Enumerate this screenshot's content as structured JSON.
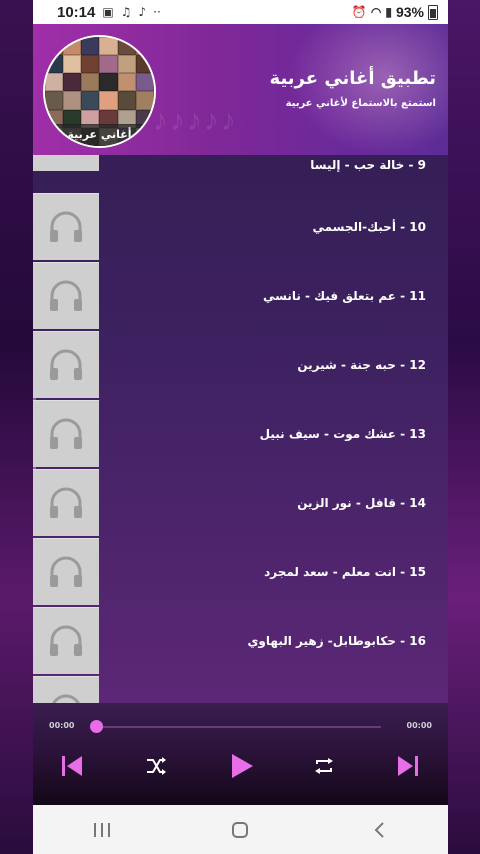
{
  "status_bar": {
    "time": "10:14",
    "battery": "93%"
  },
  "header": {
    "title": "تطبيق أغاني عربية",
    "subtitle": "استمتع بالاستماع لأغاني عربية",
    "avatar_label": "أغاني عربية"
  },
  "songs": [
    {
      "label": "9 - خالة حب - إليسا"
    },
    {
      "label": "10 - أحبك-الجسمي"
    },
    {
      "label": "11 - عم بتعلق فيك - نانسي"
    },
    {
      "label": "12 - حبه جنة - شيرين"
    },
    {
      "label": "13 - عشك موت - سيف نبيل"
    },
    {
      "label": "14 - قافل - نور الزين"
    },
    {
      "label": "15 - انت معلم - سعد لمجرد"
    },
    {
      "label": "16 - حكابوطابل- زهير البهاوي"
    }
  ],
  "player": {
    "current_time": "00:00",
    "total_time": "00:00",
    "progress": 0
  },
  "colors": {
    "accent": "#e86ee8",
    "header_start": "#a02fa8",
    "header_end": "#5d2c96"
  }
}
